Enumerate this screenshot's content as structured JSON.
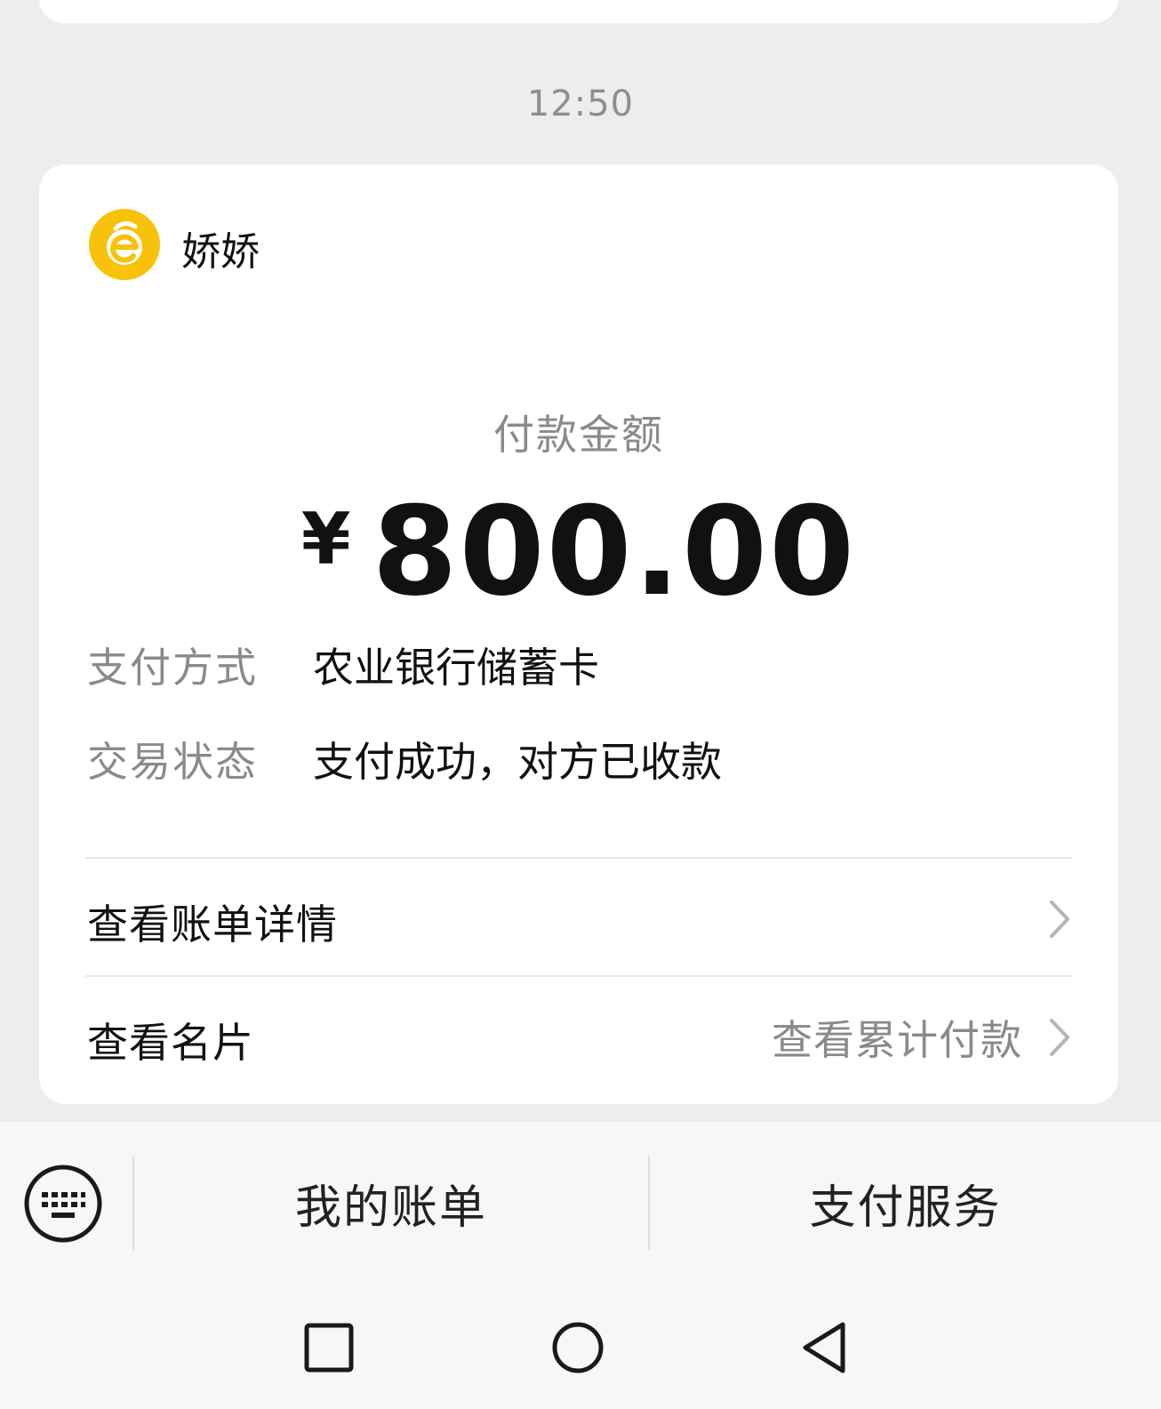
{
  "chat": {
    "timestamp": "12:50"
  },
  "payment_card": {
    "merchant_name": "娇娇",
    "avatar_icon": "merchant-logo-icon",
    "avatar_color": "#f8c20b",
    "amount_label": "付款金额",
    "currency_symbol": "¥",
    "amount": "800.00",
    "details": [
      {
        "label": "支付方式",
        "value": "农业银行储蓄卡"
      },
      {
        "label": "交易状态",
        "value": "支付成功，对方已收款"
      }
    ],
    "links": [
      {
        "title": "查看账单详情",
        "hint": ""
      },
      {
        "title": "查看名片",
        "hint": "查看累计付款"
      }
    ]
  },
  "bottom_menu": {
    "keyboard_icon": "keyboard-icon",
    "items": [
      "我的账单",
      "支付服务"
    ]
  },
  "system_nav": {
    "icons": [
      "recent-apps-icon",
      "home-icon",
      "back-icon"
    ]
  }
}
